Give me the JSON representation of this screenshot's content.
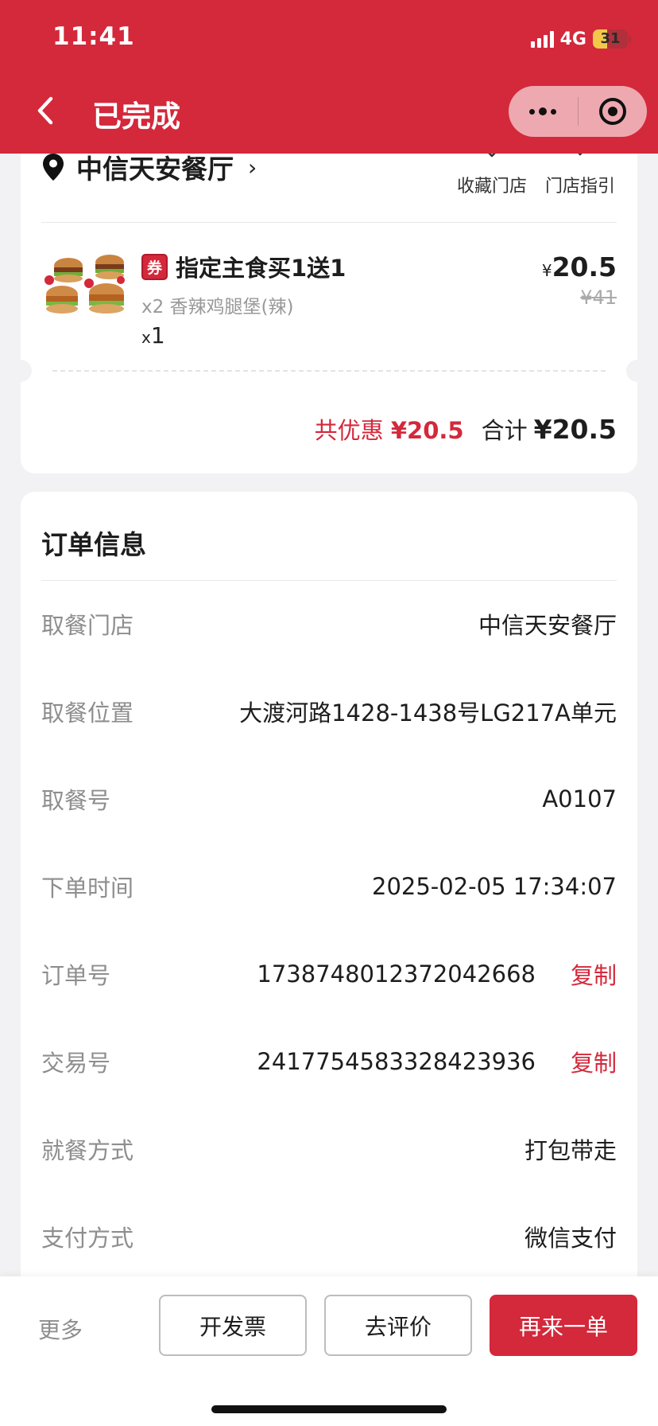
{
  "status_bar": {
    "time": "11:41",
    "network": "4G",
    "battery": "31"
  },
  "header": {
    "title": "已完成",
    "back_icon": "chevron-left-icon",
    "more_icon": "more-dots-icon",
    "close_icon": "target-circle-icon",
    "bg_color": "#d4283b"
  },
  "store": {
    "name": "中信天安餐厅",
    "arrow": "›",
    "favorite_label": "收藏门店",
    "guide_label": "门店指引"
  },
  "item": {
    "coupon_tag": "券",
    "name": "指定主食买1送1",
    "sub": "x2 香辣鸡腿堡(辣)",
    "qty_prefix": "x",
    "qty": "1",
    "price_symbol": "¥",
    "price": "20.5",
    "original_price": "¥41"
  },
  "totals": {
    "discount_label": "共优惠",
    "discount_value": "¥20.5",
    "sum_label": "合计",
    "sum_value": "¥20.5"
  },
  "order_info": {
    "title": "订单信息",
    "copy_label": "复制",
    "rows": [
      {
        "label": "取餐门店",
        "value": "中信天安餐厅"
      },
      {
        "label": "取餐位置",
        "value": "大渡河路1428-1438号LG217A单元"
      },
      {
        "label": "取餐号",
        "value": "A0107"
      },
      {
        "label": "下单时间",
        "value": "2025-02-05 17:34:07"
      },
      {
        "label": "订单号",
        "value": "1738748012372042668"
      },
      {
        "label": "交易号",
        "value": "2417754583328423936"
      },
      {
        "label": "就餐方式",
        "value": "打包带走"
      },
      {
        "label": "支付方式",
        "value": "微信支付"
      }
    ]
  },
  "bottom_bar": {
    "more": "更多",
    "invoice": "开发票",
    "review": "去评价",
    "reorder": "再来一单"
  }
}
